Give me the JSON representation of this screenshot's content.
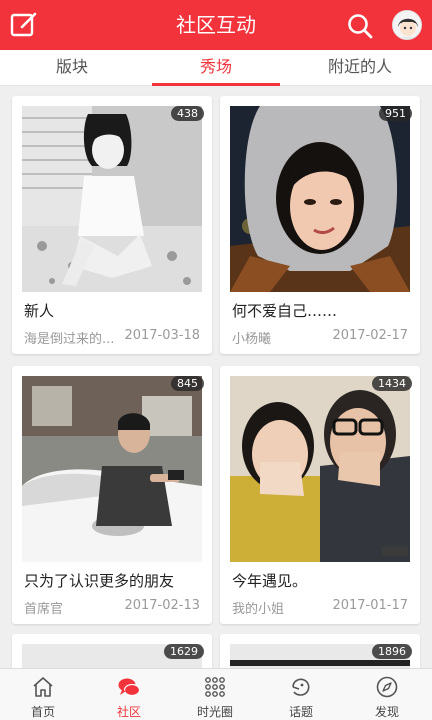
{
  "header": {
    "title": "社区互动",
    "compose_icon": "compose-icon",
    "search_icon": "search-icon",
    "avatar": "user-avatar"
  },
  "tabs": [
    {
      "label": "版块",
      "active": false
    },
    {
      "label": "秀场",
      "active": true
    },
    {
      "label": "附近的人",
      "active": false
    }
  ],
  "posts": [
    {
      "title": "新人",
      "author": "海是倒过来的...",
      "date": "2017-03-18",
      "count": "438"
    },
    {
      "title": "何不爱自己……",
      "author": "小杨曦",
      "date": "2017-02-17",
      "count": "951"
    },
    {
      "title": "只为了认识更多的朋友",
      "author": "首席官",
      "date": "2017-02-13",
      "count": "845"
    },
    {
      "title": "今年遇见。",
      "author": "我的小姐",
      "date": "2017-01-17",
      "count": "1434"
    },
    {
      "count": "1629"
    },
    {
      "count": "1896"
    }
  ],
  "tabbar": [
    {
      "label": "首页",
      "icon": "home-icon",
      "active": false
    },
    {
      "label": "社区",
      "icon": "chat-bubble-icon",
      "active": true
    },
    {
      "label": "时光圈",
      "icon": "grid-dots-icon",
      "active": false
    },
    {
      "label": "话题",
      "icon": "topic-icon",
      "active": false
    },
    {
      "label": "发现",
      "icon": "compass-icon",
      "active": false
    }
  ],
  "colors": {
    "accent": "#f2333b",
    "background": "#efefef"
  }
}
